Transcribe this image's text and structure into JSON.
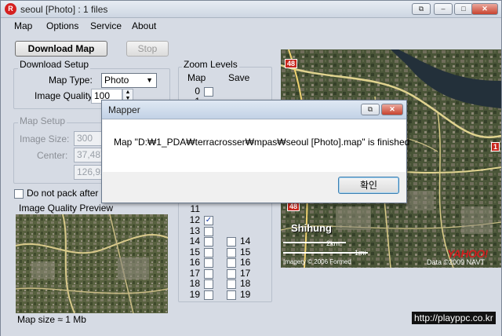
{
  "window": {
    "app_icon_text": "R",
    "title": "seoul [Photo] : 1 files",
    "controls": {
      "restore": "⧉",
      "minimize": "–",
      "maximize": "□",
      "close": "✕"
    }
  },
  "menu": [
    "Map",
    "Options",
    "Service",
    "About"
  ],
  "toolbar": {
    "download_label": "Download Map",
    "stop_label": "Stop"
  },
  "download_setup": {
    "title": "Download Setup",
    "map_type_label": "Map Type:",
    "map_type_value": "Photo",
    "image_quality_label": "Image Quality:",
    "image_quality_value": "100"
  },
  "map_setup": {
    "title": "Map Setup",
    "image_size_label": "Image Size:",
    "image_size_value": "300",
    "center_label": "Center:",
    "center_lat": "37,487",
    "center_lon": "126,92"
  },
  "options": {
    "do_not_pack_label": "Do not pack after d",
    "do_not_pack_checked": false
  },
  "preview": {
    "title": "Image Quality Preview",
    "map_size_label": "Map size ≈ 1 Mb"
  },
  "zoom_levels": {
    "title": "Zoom Levels",
    "map_header": "Map",
    "save_header": "Save",
    "map_levels_top": [
      {
        "level": "0",
        "checked": false
      },
      {
        "level": "1",
        "checked": false
      }
    ],
    "map_levels_bottom": [
      {
        "level": "11",
        "checked": false
      },
      {
        "level": "12",
        "checked": true
      },
      {
        "level": "13",
        "checked": false
      },
      {
        "level": "14",
        "checked": false
      },
      {
        "level": "15",
        "checked": false
      },
      {
        "level": "16",
        "checked": false
      },
      {
        "level": "17",
        "checked": false
      },
      {
        "level": "18",
        "checked": false
      },
      {
        "level": "19",
        "checked": false
      }
    ],
    "save_levels": [
      {
        "level": "14",
        "checked": false
      },
      {
        "level": "15",
        "checked": false
      },
      {
        "level": "16",
        "checked": false
      },
      {
        "level": "17",
        "checked": false
      },
      {
        "level": "18",
        "checked": false
      },
      {
        "level": "19",
        "checked": false
      }
    ]
  },
  "map_view": {
    "road_badge_1": "48",
    "road_badge_2": "48",
    "road_badge_3": "1",
    "place_label": "Shihung",
    "scale_km": "2km",
    "scale_mi": "1mi",
    "provider_logo": "YAHOO!",
    "imagery_credit": "Imagery © 2006 Formed",
    "data_credit": "Data ©2009 NAVT"
  },
  "dialog": {
    "title": "Mapper",
    "message": "Map \"D:₩1_PDA₩terracrosser₩mpas₩seoul [Photo].map\" is finished",
    "confirm_label": "확인",
    "controls": {
      "restore": "⧉",
      "close": "✕"
    }
  },
  "watermark": "http://playppc.co.kr",
  "colors": {
    "title_bar": "#cdd6e2",
    "window_bg": "#d6dbe4",
    "close_button": "#c8432f",
    "dialog_bg": "#f0f0f0"
  }
}
